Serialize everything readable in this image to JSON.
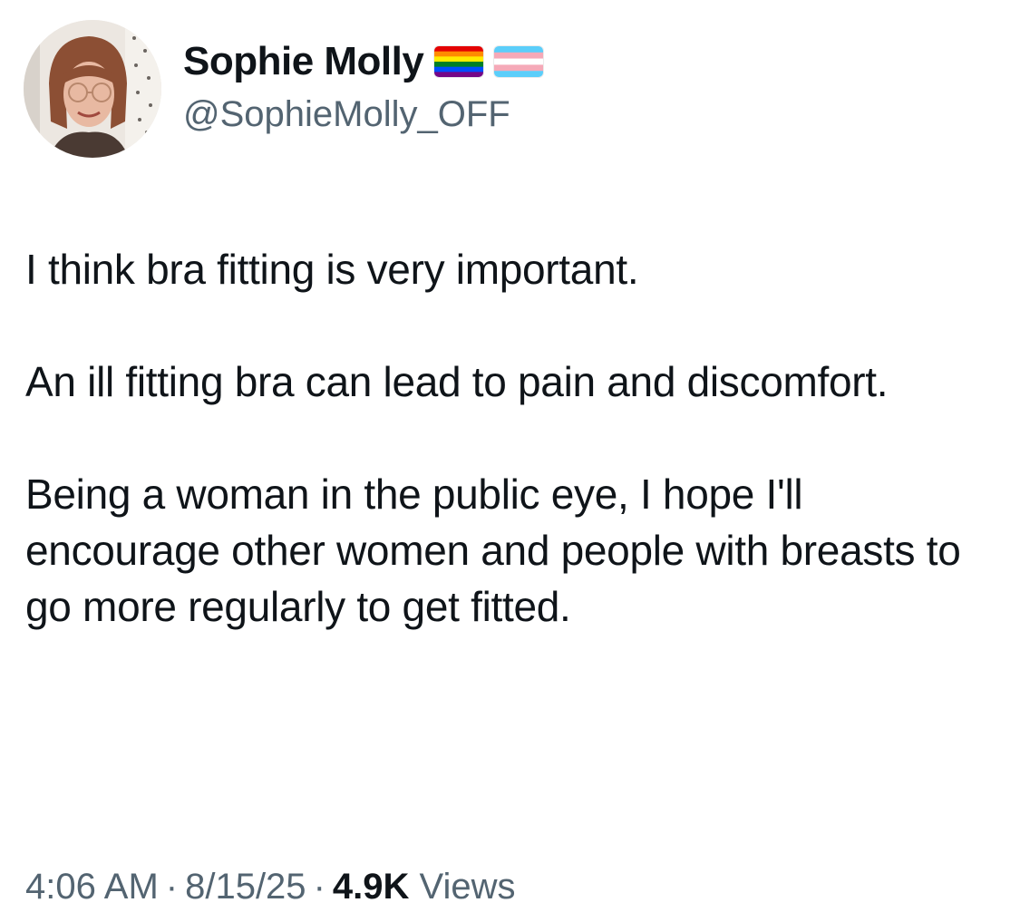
{
  "author": {
    "display_name": "Sophie Molly",
    "handle": "@SophieMolly_OFF",
    "badges": [
      "rainbow-pride-flag",
      "transgender-flag"
    ]
  },
  "tweet": {
    "paragraphs": [
      "I think bra fitting is very important.",
      "An ill fitting bra can lead to pain and discomfort.",
      "Being a woman in the public eye, I hope I'll encourage other women and people with breasts to go more regularly to get fitted."
    ],
    "time": "4:06 AM",
    "date": "8/15/25",
    "separator": "·",
    "views_count": "4.9K",
    "views_label": "Views"
  },
  "colors": {
    "text_primary": "#0f1419",
    "text_secondary": "#536471"
  }
}
